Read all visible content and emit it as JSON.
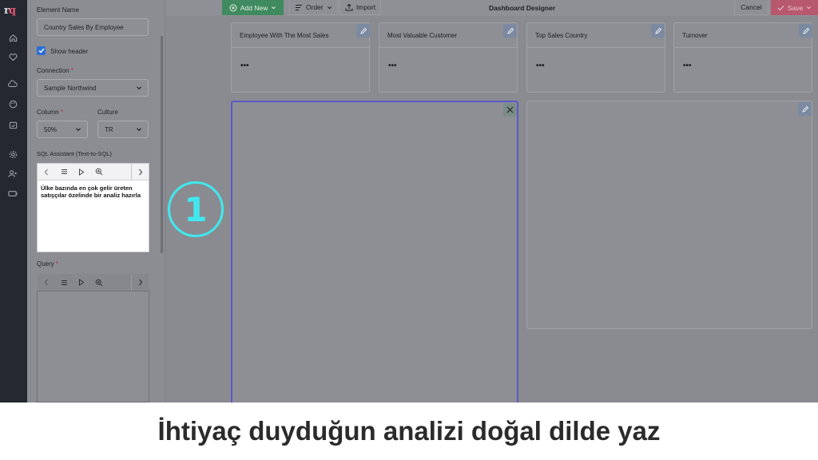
{
  "app": {
    "logo_r": "r",
    "logo_q": "q"
  },
  "rail": {
    "icons": [
      "home-icon",
      "heart-icon",
      "cloud-icon",
      "palette-icon",
      "calendar-check-icon",
      "gear-icon",
      "user-plus-icon",
      "battery-icon"
    ]
  },
  "panel": {
    "element_name_label": "Element Name",
    "element_name_value": "Country Sales By Employee",
    "show_header_label": "Show header",
    "connection_label": "Connection",
    "connection_value": "Sample Northwind",
    "column_label": "Column",
    "column_value": "50%",
    "culture_label": "Culture",
    "culture_value": "TR",
    "required_mark": "*",
    "sql_assistant_label": "SQL Assistant (Text-to-SQL)",
    "sql_assistant_text": "Ülke bazında en çok gelir üreten satışçılar özelinde bir analiz hazırla",
    "query_label": "Query"
  },
  "topbar": {
    "add_new_label": "Add New",
    "order_label": "Order",
    "import_label": "Import",
    "title": "Dashboard Designer",
    "cancel_label": "Cancel",
    "save_label": "Save"
  },
  "cards": [
    {
      "title": "Employee With The Most Sales",
      "value": "•••"
    },
    {
      "title": "Most Valuable Customer",
      "value": "•••"
    },
    {
      "title": "Top Sales Country",
      "value": "•••"
    },
    {
      "title": "Turnover",
      "value": "•••"
    }
  ],
  "step_badge": "1",
  "caption": "İhtiyaç duyduğun analizi doğal dilde yaz",
  "colors": {
    "accent_green": "#3f8a5f",
    "save_pink": "#b8586e",
    "badge_cyan": "#3fe8ee",
    "selected_border": "#5a59c7"
  }
}
